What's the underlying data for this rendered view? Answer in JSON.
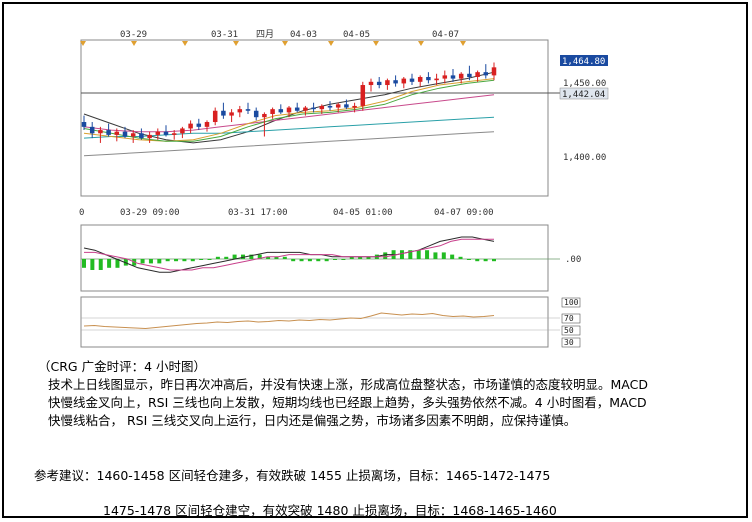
{
  "chart_data": {
    "type": "candlestick",
    "instrument_hint": "gold 4-hour",
    "top_dates": [
      "03-29",
      "03-31",
      "四月",
      "04-03",
      "04-05",
      "04-07"
    ],
    "bottom_times": [
      "0",
      "03-29 09:00",
      "03-31 17:00",
      "04-05 01:00",
      "04-07 09:00"
    ],
    "price_labels": [
      "1,464.80",
      "1,450.00",
      "1,442.04",
      "1,400.00"
    ],
    "price_ylim": [
      1385,
      1482
    ],
    "macd_label": ".00",
    "rsi_labels": [
      "100",
      "70",
      "50",
      "30"
    ],
    "candles": [
      {
        "o": 1431,
        "h": 1435,
        "l": 1426,
        "c": 1428
      },
      {
        "o": 1428,
        "h": 1431,
        "l": 1421,
        "c": 1424
      },
      {
        "o": 1424,
        "h": 1428,
        "l": 1418,
        "c": 1426
      },
      {
        "o": 1426,
        "h": 1430,
        "l": 1422,
        "c": 1423
      },
      {
        "o": 1423,
        "h": 1427,
        "l": 1419,
        "c": 1425
      },
      {
        "o": 1425,
        "h": 1428,
        "l": 1421,
        "c": 1422
      },
      {
        "o": 1422,
        "h": 1426,
        "l": 1418,
        "c": 1424
      },
      {
        "o": 1424,
        "h": 1427,
        "l": 1420,
        "c": 1421
      },
      {
        "o": 1421,
        "h": 1425,
        "l": 1418,
        "c": 1423
      },
      {
        "o": 1423,
        "h": 1427,
        "l": 1420,
        "c": 1425
      },
      {
        "o": 1425,
        "h": 1429,
        "l": 1422,
        "c": 1423
      },
      {
        "o": 1423,
        "h": 1426,
        "l": 1420,
        "c": 1424
      },
      {
        "o": 1424,
        "h": 1428,
        "l": 1421,
        "c": 1427
      },
      {
        "o": 1427,
        "h": 1432,
        "l": 1424,
        "c": 1430
      },
      {
        "o": 1430,
        "h": 1433,
        "l": 1426,
        "c": 1428
      },
      {
        "o": 1428,
        "h": 1432,
        "l": 1425,
        "c": 1431
      },
      {
        "o": 1431,
        "h": 1440,
        "l": 1429,
        "c": 1438
      },
      {
        "o": 1438,
        "h": 1443,
        "l": 1433,
        "c": 1435
      },
      {
        "o": 1435,
        "h": 1439,
        "l": 1431,
        "c": 1437
      },
      {
        "o": 1437,
        "h": 1441,
        "l": 1434,
        "c": 1439
      },
      {
        "o": 1439,
        "h": 1443,
        "l": 1436,
        "c": 1438
      },
      {
        "o": 1438,
        "h": 1440,
        "l": 1432,
        "c": 1434
      },
      {
        "o": 1434,
        "h": 1437,
        "l": 1422,
        "c": 1436
      },
      {
        "o": 1436,
        "h": 1440,
        "l": 1433,
        "c": 1439
      },
      {
        "o": 1439,
        "h": 1442,
        "l": 1436,
        "c": 1437
      },
      {
        "o": 1437,
        "h": 1441,
        "l": 1434,
        "c": 1440
      },
      {
        "o": 1440,
        "h": 1443,
        "l": 1437,
        "c": 1438
      },
      {
        "o": 1438,
        "h": 1441,
        "l": 1435,
        "c": 1440
      },
      {
        "o": 1440,
        "h": 1443,
        "l": 1437,
        "c": 1439
      },
      {
        "o": 1439,
        "h": 1442,
        "l": 1436,
        "c": 1441
      },
      {
        "o": 1441,
        "h": 1444,
        "l": 1438,
        "c": 1440
      },
      {
        "o": 1440,
        "h": 1443,
        "l": 1437,
        "c": 1442
      },
      {
        "o": 1442,
        "h": 1445,
        "l": 1439,
        "c": 1440
      },
      {
        "o": 1440,
        "h": 1443,
        "l": 1437,
        "c": 1441
      },
      {
        "o": 1441,
        "h": 1456,
        "l": 1438,
        "c": 1454
      },
      {
        "o": 1454,
        "h": 1458,
        "l": 1450,
        "c": 1456
      },
      {
        "o": 1456,
        "h": 1459,
        "l": 1452,
        "c": 1454
      },
      {
        "o": 1454,
        "h": 1458,
        "l": 1451,
        "c": 1457
      },
      {
        "o": 1457,
        "h": 1460,
        "l": 1453,
        "c": 1455
      },
      {
        "o": 1455,
        "h": 1459,
        "l": 1452,
        "c": 1458
      },
      {
        "o": 1458,
        "h": 1461,
        "l": 1454,
        "c": 1456
      },
      {
        "o": 1456,
        "h": 1460,
        "l": 1453,
        "c": 1459
      },
      {
        "o": 1459,
        "h": 1462,
        "l": 1455,
        "c": 1457
      },
      {
        "o": 1457,
        "h": 1461,
        "l": 1454,
        "c": 1458
      },
      {
        "o": 1458,
        "h": 1463,
        "l": 1455,
        "c": 1460
      },
      {
        "o": 1460,
        "h": 1464,
        "l": 1456,
        "c": 1458
      },
      {
        "o": 1458,
        "h": 1462,
        "l": 1455,
        "c": 1461
      },
      {
        "o": 1461,
        "h": 1466,
        "l": 1457,
        "c": 1459
      },
      {
        "o": 1459,
        "h": 1463,
        "l": 1456,
        "c": 1462
      },
      {
        "o": 1462,
        "h": 1467,
        "l": 1458,
        "c": 1460
      },
      {
        "o": 1460,
        "h": 1468,
        "l": 1457,
        "c": 1465
      }
    ],
    "moving_averages": [
      {
        "color": "#3a3a3a",
        "values": [
          1436,
          1430,
          1424,
          1420,
          1418,
          1420,
          1425,
          1432,
          1438,
          1442,
          1445,
          1448,
          1452,
          1455,
          1458,
          1462
        ]
      },
      {
        "color": "#c84a8c",
        "values": [
          1428,
          1426,
          1425,
          1425,
          1426,
          1428,
          1430,
          1432,
          1434,
          1436,
          1438,
          1440,
          1442,
          1444,
          1446,
          1448
        ]
      },
      {
        "color": "#2aa0a8",
        "values": [
          1421,
          1422,
          1422,
          1423,
          1424,
          1424,
          1425,
          1426,
          1427,
          1428,
          1429,
          1430,
          1431,
          1432,
          1433,
          1434
        ]
      },
      {
        "color": "#8a8a8a",
        "values": [
          1410,
          1411,
          1412,
          1413,
          1414,
          1415,
          1416,
          1417,
          1418,
          1419,
          1420,
          1421,
          1422,
          1423,
          1424,
          1425
        ]
      },
      {
        "color": "#d8a030",
        "values": [
          1424,
          1422,
          1420,
          1419,
          1420,
          1424,
          1430,
          1435,
          1437,
          1438,
          1440,
          1444,
          1450,
          1454,
          1456,
          1458
        ]
      },
      {
        "color": "#4aa840",
        "values": [
          1427,
          1424,
          1421,
          1419,
          1419,
          1422,
          1428,
          1433,
          1436,
          1437,
          1439,
          1442,
          1448,
          1452,
          1455,
          1457
        ]
      }
    ],
    "macd_hist": [
      -4,
      -5,
      -5,
      -4,
      -4,
      -3,
      -3,
      -2,
      -2,
      -2,
      -1,
      -1,
      -1,
      -1,
      0,
      0,
      1,
      1,
      2,
      2,
      2,
      2,
      1,
      1,
      1,
      -1,
      -1,
      -1,
      -1,
      -1,
      0,
      0,
      1,
      1,
      1,
      2,
      3,
      4,
      4,
      4,
      4,
      4,
      3,
      3,
      2,
      1,
      0,
      -1,
      -1,
      -1
    ],
    "macd_fast": [
      5,
      4,
      2,
      0,
      -2,
      -4,
      -5,
      -6,
      -6,
      -5,
      -4,
      -3,
      -2,
      -1,
      0,
      1,
      2,
      3,
      3,
      3,
      3,
      2,
      2,
      1,
      1,
      1,
      1,
      1,
      2,
      2,
      3,
      4,
      6,
      8,
      9,
      10,
      10,
      9,
      8
    ],
    "macd_slow": [
      3,
      3,
      2,
      1,
      0,
      -2,
      -3,
      -4,
      -5,
      -5,
      -5,
      -4,
      -4,
      -3,
      -2,
      -1,
      0,
      1,
      1,
      2,
      2,
      2,
      2,
      2,
      1,
      1,
      1,
      1,
      1,
      2,
      3,
      4,
      5,
      6,
      8,
      9,
      9,
      9,
      9
    ],
    "rsi": [
      42,
      43,
      41,
      40,
      39,
      38,
      37,
      39,
      41,
      43,
      45,
      47,
      48,
      50,
      49,
      51,
      52,
      50,
      51,
      53,
      52,
      54,
      53,
      55,
      54,
      56,
      58,
      57,
      62,
      68,
      66,
      64,
      66,
      65,
      67,
      63,
      61,
      62,
      60,
      61,
      63
    ]
  },
  "commentary": {
    "title": "（CRG 广金时评：4 小时图）",
    "line1": "技术上日线图显示，昨日再次冲高后，并没有快速上涨，形成高位盘整状态，市场谨慎的态度较明显。MACD",
    "line2": "快慢线金叉向上，RSI 三线也向上发散，短期均线也已经跟上趋势，多头强势依然不减。4 小时图看，MACD",
    "line3": "快慢线粘合，  RSI 三线交叉向上运行，日内还是偏强之势，市场诸多因素不明朗，应保持谨慎。"
  },
  "advice": {
    "line1": "参考建议：1460-1458 区间轻仓建多，有效跌破 1455 止损离场，目标：1465-1472-1475",
    "line2": "1475-1478 区间轻仓建空，有效突破 1480 止损离场，目标：1468-1465-1460"
  }
}
